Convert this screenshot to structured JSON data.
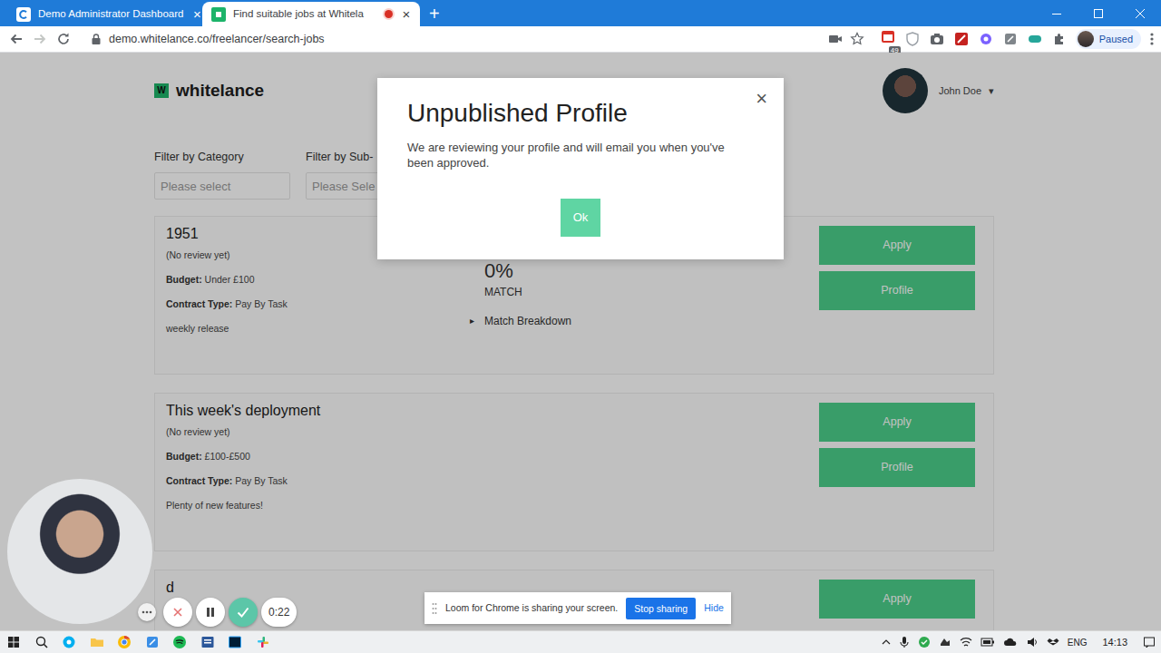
{
  "browser": {
    "tabs": [
      {
        "title": "Demo Administrator Dashboard",
        "selected": false,
        "close": "×"
      },
      {
        "title": "Find suitable jobs at Whitela",
        "selected": true,
        "recording": true,
        "close": "×"
      }
    ],
    "new_tab": "+",
    "nav": {
      "back_enabled": true,
      "forward_enabled": false
    },
    "url": "demo.whitelance.co/freelancer/search-jobs",
    "extension_badge": "49",
    "profile_status": "Paused"
  },
  "header": {
    "logo_mark": "W",
    "logo": "whitelance",
    "user": "John Doe",
    "caret": "▾"
  },
  "filters": [
    {
      "label": "Filter by Category",
      "placeholder": "Please select"
    },
    {
      "label": "Filter by Sub-",
      "placeholder": "Please Sele"
    }
  ],
  "jobs": [
    {
      "title": "1951",
      "review": "(No review yet)",
      "budget_label": "Budget:",
      "budget": "Under £100",
      "contract_label": "Contract Type:",
      "contract": "Pay By Task",
      "description": "weekly release",
      "match": {
        "value": "0%",
        "label": "MATCH",
        "toggle": "▸",
        "breakdown": "Match Breakdown",
        "expanded": false
      },
      "buttons": [
        "Apply",
        "Profile"
      ]
    },
    {
      "title": "This week's deployment",
      "review": "(No review yet)",
      "budget_label": "Budget:",
      "budget": "£100-£500",
      "contract_label": "Contract Type:",
      "contract": "Pay By Task",
      "description": "Plenty of new features!",
      "buttons": [
        "Apply",
        "Profile"
      ]
    },
    {
      "title": "d",
      "buttons": [
        "Apply"
      ]
    }
  ],
  "modal": {
    "title": "Unpublished Profile",
    "message": "We are reviewing your profile and will email you when you've been approved.",
    "close": "×",
    "button": "Ok"
  },
  "loom": {
    "timer": "0:22",
    "share_text": "Loom for Chrome is sharing your screen.",
    "stop": "Stop sharing",
    "hide": "Hide"
  },
  "taskbar": {
    "language": "ENG",
    "time": "14:13"
  }
}
